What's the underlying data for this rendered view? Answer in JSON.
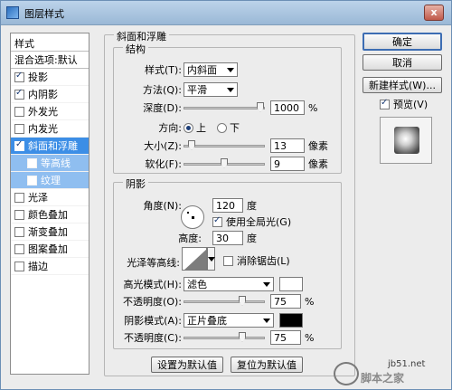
{
  "window": {
    "title": "图层样式",
    "close": "x"
  },
  "left_panel": {
    "header": "样式",
    "blend": "混合选项:默认",
    "items": [
      {
        "label": "投影",
        "checked": true,
        "state": "normal"
      },
      {
        "label": "内阴影",
        "checked": true,
        "state": "normal"
      },
      {
        "label": "外发光",
        "checked": false,
        "state": "normal"
      },
      {
        "label": "内发光",
        "checked": false,
        "state": "normal"
      },
      {
        "label": "斜面和浮雕",
        "checked": true,
        "state": "selected"
      },
      {
        "label": "等高线",
        "checked": false,
        "state": "sub"
      },
      {
        "label": "纹理",
        "checked": false,
        "state": "sub"
      },
      {
        "label": "光泽",
        "checked": false,
        "state": "normal"
      },
      {
        "label": "颜色叠加",
        "checked": false,
        "state": "normal"
      },
      {
        "label": "渐变叠加",
        "checked": false,
        "state": "normal"
      },
      {
        "label": "图案叠加",
        "checked": false,
        "state": "normal"
      },
      {
        "label": "描边",
        "checked": false,
        "state": "normal"
      }
    ]
  },
  "bevel": {
    "title": "斜面和浮雕",
    "structure": {
      "title": "结构",
      "style_label": "样式(T):",
      "style_value": "内斜面",
      "technique_label": "方法(Q):",
      "technique_value": "平滑",
      "depth_label": "深度(D):",
      "depth_value": "1000",
      "depth_unit": "%",
      "depth_level": 1.0,
      "direction_label": "方向:",
      "dir_up": "上",
      "dir_down": "下",
      "size_label": "大小(Z):",
      "size_value": "13",
      "size_unit": "像素",
      "size_level": 0.05,
      "soften_label": "软化(F):",
      "soften_value": "9",
      "soften_unit": "像素",
      "soften_level": 0.5
    },
    "shading": {
      "title": "阴影",
      "angle_label": "角度(N):",
      "angle_value": "120",
      "angle_unit": "度",
      "global_light": "使用全局光(G)",
      "altitude_label": "高度:",
      "altitude_value": "30",
      "altitude_unit": "度",
      "gloss_label": "光泽等高线:",
      "antialias": "消除锯齿(L)",
      "highlight_mode_label": "高光模式(H):",
      "highlight_mode_value": "滤色",
      "highlight_color": "#ffffff",
      "highlight_opacity_label": "不透明度(O):",
      "highlight_opacity_value": "75",
      "highlight_opacity_level": 0.75,
      "shadow_mode_label": "阴影模式(A):",
      "shadow_mode_value": "正片叠底",
      "shadow_color": "#000000",
      "shadow_opacity_label": "不透明度(C):",
      "shadow_opacity_value": "75",
      "shadow_opacity_level": 0.75,
      "percent": "%"
    },
    "make_default": "设置为默认值",
    "reset_default": "复位为默认值"
  },
  "buttons": {
    "ok": "确定",
    "cancel": "取消",
    "new_style": "新建样式(W)...",
    "preview": "预览(V)"
  },
  "watermark": {
    "url": "jb51.net",
    "name": "脚本之家"
  }
}
